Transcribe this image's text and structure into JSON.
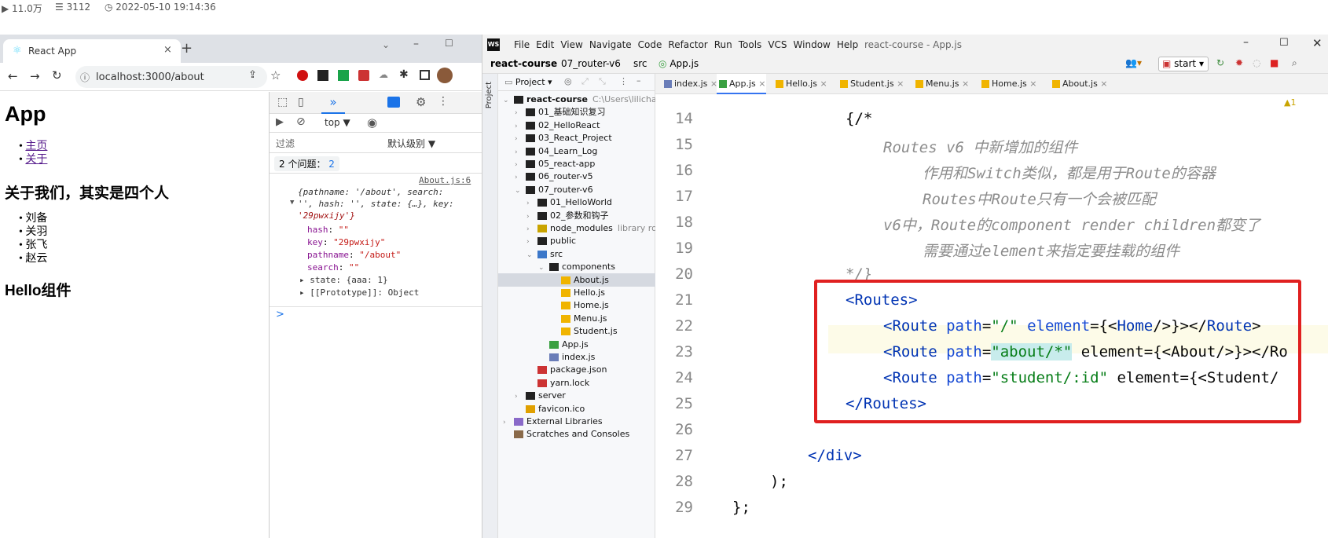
{
  "stats": {
    "views": "11.0万",
    "comments": "3112",
    "date": "2022-05-10 19:14:36"
  },
  "browser": {
    "tab_title": "React App",
    "url": "localhost:3000/about",
    "page": {
      "h1": "App",
      "nav": [
        "主页",
        "关于"
      ],
      "about_title": "关于我们，其实是四个人",
      "members": [
        "刘备",
        "关羽",
        "张飞",
        "赵云"
      ],
      "hello": "Hello组件"
    },
    "devtools": {
      "context": "top",
      "filter_placeholder": "过滤",
      "level": "默认级别 ▼",
      "issues_label": "2 个问题：",
      "issues_count": "2",
      "source_link": "About.js:6",
      "log_lines": [
        "{pathname: '/about', search:",
        "'', hash: '', state: {…}, key:",
        "'29pwxijy'}"
      ],
      "props": [
        {
          "k": "hash",
          "v": "\"\""
        },
        {
          "k": "key",
          "v": "\"29pwxijy\""
        },
        {
          "k": "pathname",
          "v": "\"/about\""
        },
        {
          "k": "search",
          "v": "\"\""
        }
      ],
      "state_line": "state: {aaa: 1}",
      "proto_line": "[[Prototype]]: Object",
      "prompt": ">"
    }
  },
  "ide": {
    "menu": [
      "File",
      "Edit",
      "View",
      "Navigate",
      "Code",
      "Refactor",
      "Run",
      "Tools",
      "VCS",
      "Window",
      "Help"
    ],
    "window_title": "react-course - App.js",
    "breadcrumb": [
      "react-course",
      "07_router-v6",
      "src",
      "App.js"
    ],
    "run_config": "start",
    "project_label": "Project",
    "tree": [
      {
        "label": "react-course",
        "extra": "C:\\Users\\lilichao\\D",
        "indent": 0,
        "kind": "folder-open"
      },
      {
        "label": "01_基础知识复习",
        "indent": 1,
        "kind": "folder"
      },
      {
        "label": "02_HelloReact",
        "indent": 1,
        "kind": "folder"
      },
      {
        "label": "03_React_Project",
        "indent": 1,
        "kind": "folder"
      },
      {
        "label": "04_Learn_Log",
        "indent": 1,
        "kind": "folder"
      },
      {
        "label": "05_react-app",
        "indent": 1,
        "kind": "folder"
      },
      {
        "label": "06_router-v5",
        "indent": 1,
        "kind": "folder"
      },
      {
        "label": "07_router-v6",
        "indent": 1,
        "kind": "folder-open"
      },
      {
        "label": "01_HelloWorld",
        "indent": 2,
        "kind": "folder"
      },
      {
        "label": "02_参数和钩子",
        "indent": 2,
        "kind": "folder"
      },
      {
        "label": "node_modules",
        "extra": "library roo",
        "indent": 2,
        "kind": "folder-lib"
      },
      {
        "label": "public",
        "indent": 2,
        "kind": "folder"
      },
      {
        "label": "src",
        "indent": 2,
        "kind": "folder-src"
      },
      {
        "label": "components",
        "indent": 3,
        "kind": "folder-open"
      },
      {
        "label": "About.js",
        "indent": 4,
        "kind": "js",
        "selected": true
      },
      {
        "label": "Hello.js",
        "indent": 4,
        "kind": "js"
      },
      {
        "label": "Home.js",
        "indent": 4,
        "kind": "js"
      },
      {
        "label": "Menu.js",
        "indent": 4,
        "kind": "js"
      },
      {
        "label": "Student.js",
        "indent": 4,
        "kind": "js"
      },
      {
        "label": "App.js",
        "indent": 3,
        "kind": "jsx"
      },
      {
        "label": "index.js",
        "indent": 3,
        "kind": "jsfile"
      },
      {
        "label": "package.json",
        "indent": 2,
        "kind": "json"
      },
      {
        "label": "yarn.lock",
        "indent": 2,
        "kind": "lock"
      },
      {
        "label": "server",
        "indent": 1,
        "kind": "folder"
      },
      {
        "label": "favicon.ico",
        "indent": 1,
        "kind": "star"
      },
      {
        "label": "External Libraries",
        "indent": 0,
        "kind": "lib"
      },
      {
        "label": "Scratches and Consoles",
        "indent": 0,
        "kind": "scratch"
      }
    ],
    "tabs": [
      "index.js",
      "App.js",
      "Hello.js",
      "Student.js",
      "Menu.js",
      "Home.js",
      "About.js"
    ],
    "active_tab": "App.js",
    "inspection": "▲1",
    "line_numbers": [
      "14",
      "15",
      "16",
      "17",
      "18",
      "19",
      "20",
      "21",
      "22",
      "23",
      "24",
      "25",
      "26",
      "27",
      "28",
      "29"
    ],
    "code": {
      "l14": "{/*",
      "l15a": "Routes v6 ",
      "l15b": "中新增加的组件",
      "l16": "作用和Switch类似，都是用于Route的容器",
      "l17": "Routes中Route只有一个会被匹配",
      "l18": "v6中，Route的component render children都变了",
      "l19": "需要通过element来指定要挂载的组件",
      "l20": "*/}",
      "routes_open": "<Routes>",
      "route1": [
        "<Route ",
        "path",
        "=",
        "\"/\"",
        " element",
        "={<",
        "Home",
        "/>}></",
        "Route",
        ">"
      ],
      "route2_path": "\"about/*\"",
      "route2_rest": "element={<About/>}></Ro",
      "route3_path": "\"student/:id\"",
      "route3_rest": "element={<Student/",
      "routes_close": "</Routes>",
      "div_close": "</div>",
      "paren": ");",
      "end": "};"
    },
    "highlight_color": "#e02020"
  }
}
